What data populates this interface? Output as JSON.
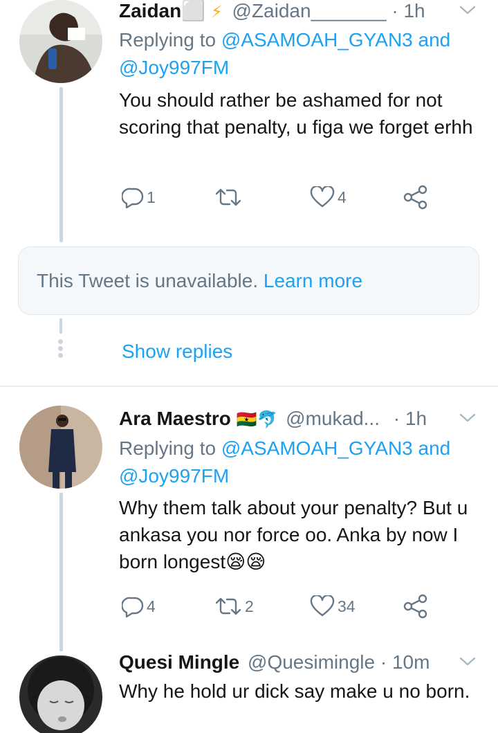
{
  "tweets": [
    {
      "name": "Zaidan⬜",
      "name_emoji": "⚡",
      "handle": "@Zaidan_______",
      "time": "1h",
      "replying_prefix": "Replying to ",
      "replying_line1": "@ASAMOAH_GYAN3 and",
      "replying_line2": "@Joy997FM",
      "text": "You should rather be ashamed for not scoring that penalty, u figa we forget erhh",
      "reply_count": "1",
      "retweet_count": "",
      "like_count": "4"
    },
    {
      "name": "Ara Maestro",
      "name_emoji": "🇬🇭🐬",
      "handle": "@mukad...",
      "time": "1h",
      "replying_prefix": "Replying to ",
      "replying_line1": "@ASAMOAH_GYAN3 and",
      "replying_line2": "@Joy997FM",
      "text": "Why them talk about your penalty? But u ankasa you nor force oo. Anka by now I born longest😪😪",
      "reply_count": "4",
      "retweet_count": "2",
      "like_count": "34"
    },
    {
      "name": "Quesi Mingle",
      "handle": "@Quesimingle",
      "time": "10m",
      "text": "Why he hold ur dick say make u no born."
    }
  ],
  "unavailable": {
    "text": "This Tweet is unavailable. ",
    "link": "Learn more"
  },
  "show_replies": "Show replies",
  "separator": "·",
  "colors": {
    "link": "#1da1f2",
    "muted": "#657786",
    "text": "#14171a",
    "thread_line": "#cdd5dc"
  },
  "icons": [
    "reply-icon",
    "retweet-icon",
    "like-icon",
    "share-icon",
    "chevron-down-icon"
  ]
}
